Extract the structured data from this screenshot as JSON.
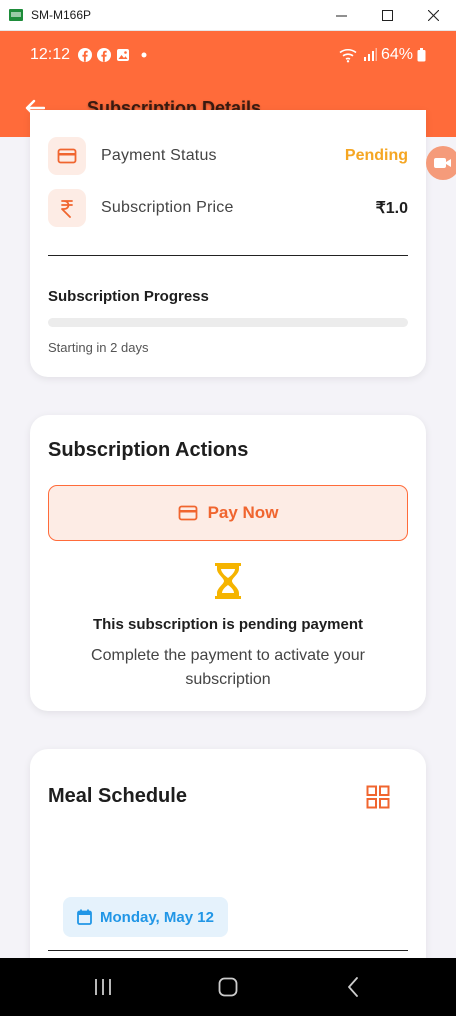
{
  "window": {
    "title": "SM-M166P",
    "minimize_glyph": "—",
    "maximize_glyph": "☐",
    "close_glyph": "✕"
  },
  "status_bar": {
    "time": "12:12",
    "notification_icons": [
      "facebook-icon",
      "facebook-icon",
      "image-icon",
      "dot-icon"
    ],
    "battery": "64%"
  },
  "app_bar": {
    "title": "Subscription Details",
    "back_icon": "arrow-left-icon"
  },
  "details": {
    "payment_status_label": "Payment Status",
    "payment_status_value": "Pending",
    "price_label": "Subscription Price",
    "price_value": "₹1.0",
    "progress_title": "Subscription Progress",
    "progress_fraction": 0,
    "progress_note": "Starting in 2 days"
  },
  "actions": {
    "title": "Subscription Actions",
    "pay_button": "Pay Now",
    "pending_title": "This subscription is pending payment",
    "pending_message": "Complete the payment to activate your subscription"
  },
  "meal_schedule": {
    "title": "Meal Schedule",
    "date_chip": "Monday, May 12"
  },
  "colors": {
    "brand": "#ff6b3a",
    "pending": "#f5a623",
    "date_blue": "#2196e6",
    "hourglass": "#f5b400"
  }
}
